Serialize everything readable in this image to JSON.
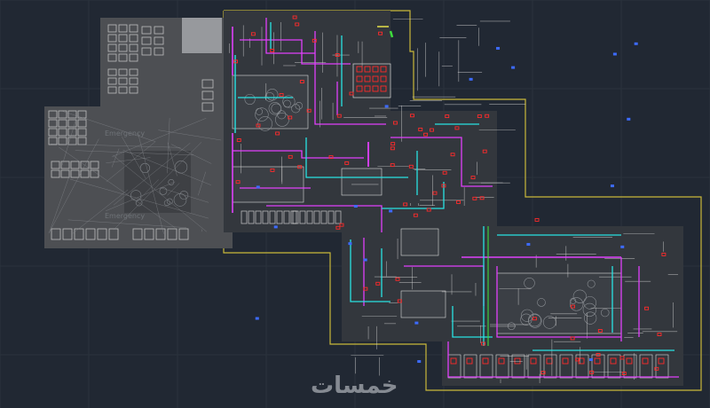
{
  "viewport": {
    "background": "#212833",
    "grid_color": "#2a323d"
  },
  "colors": {
    "outline": "#c9b83a",
    "left_block": "#4d4f53",
    "left_block_dark": "#3e4044",
    "plan_fill": "#33373d",
    "room_fill": "#3b3f45",
    "white_lines": "#d9d9d9",
    "grey_lines": "#8e9196",
    "magenta": "#e040fb",
    "cyan": "#29e3e3",
    "red": "#ff2b2b",
    "blue": "#3d6bff",
    "green": "#3ddc3d",
    "yellow": "#e6e04a"
  },
  "labels": {
    "emergency_1": "Emergency",
    "emergency_2": "Emergency"
  },
  "watermark": {
    "text": "خمسات"
  }
}
